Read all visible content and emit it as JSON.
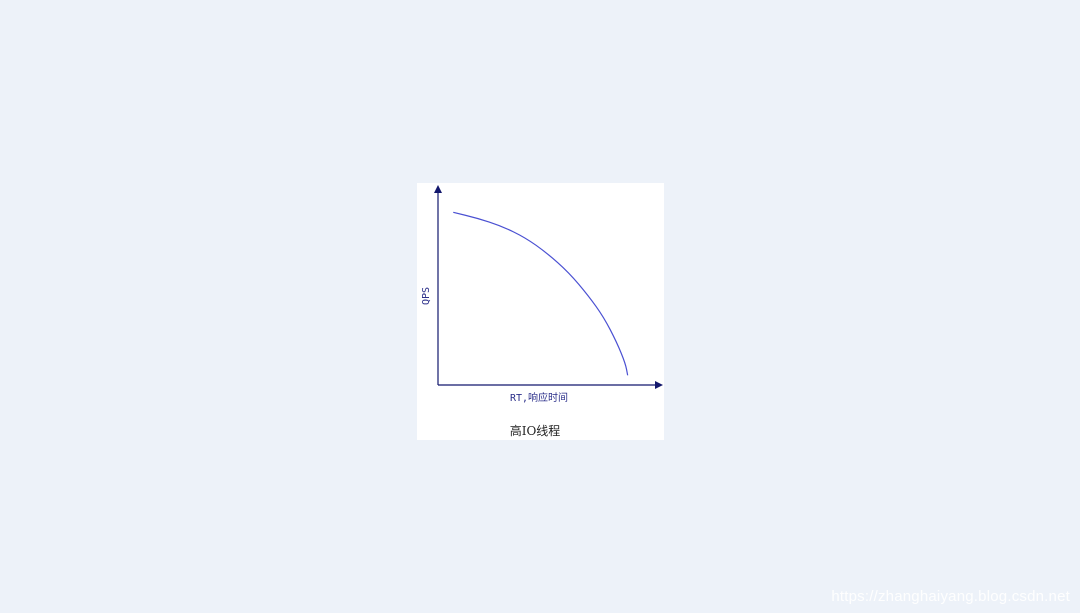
{
  "chart_data": {
    "type": "line",
    "title": "高IO线程",
    "xlabel": "RT,响应时间",
    "ylabel": "QPS",
    "xlim": [
      0,
      10
    ],
    "ylim": [
      0,
      10
    ],
    "grid": false,
    "series": [
      {
        "values": [
          {
            "x": 0.7,
            "y": 8.9
          },
          {
            "x": 1.8,
            "y": 8.6
          },
          {
            "x": 2.9,
            "y": 8.2
          },
          {
            "x": 4.0,
            "y": 7.6
          },
          {
            "x": 5.0,
            "y": 6.8
          },
          {
            "x": 6.0,
            "y": 5.8
          },
          {
            "x": 6.9,
            "y": 4.6
          },
          {
            "x": 7.6,
            "y": 3.5
          },
          {
            "x": 8.2,
            "y": 2.2
          },
          {
            "x": 8.6,
            "y": 1.1
          },
          {
            "x": 8.7,
            "y": 0.5
          }
        ]
      }
    ],
    "colors": {
      "axis": "#13186d",
      "series": "#4a50d2"
    }
  },
  "watermark": "https://zhanghaiyang.blog.csdn.net"
}
